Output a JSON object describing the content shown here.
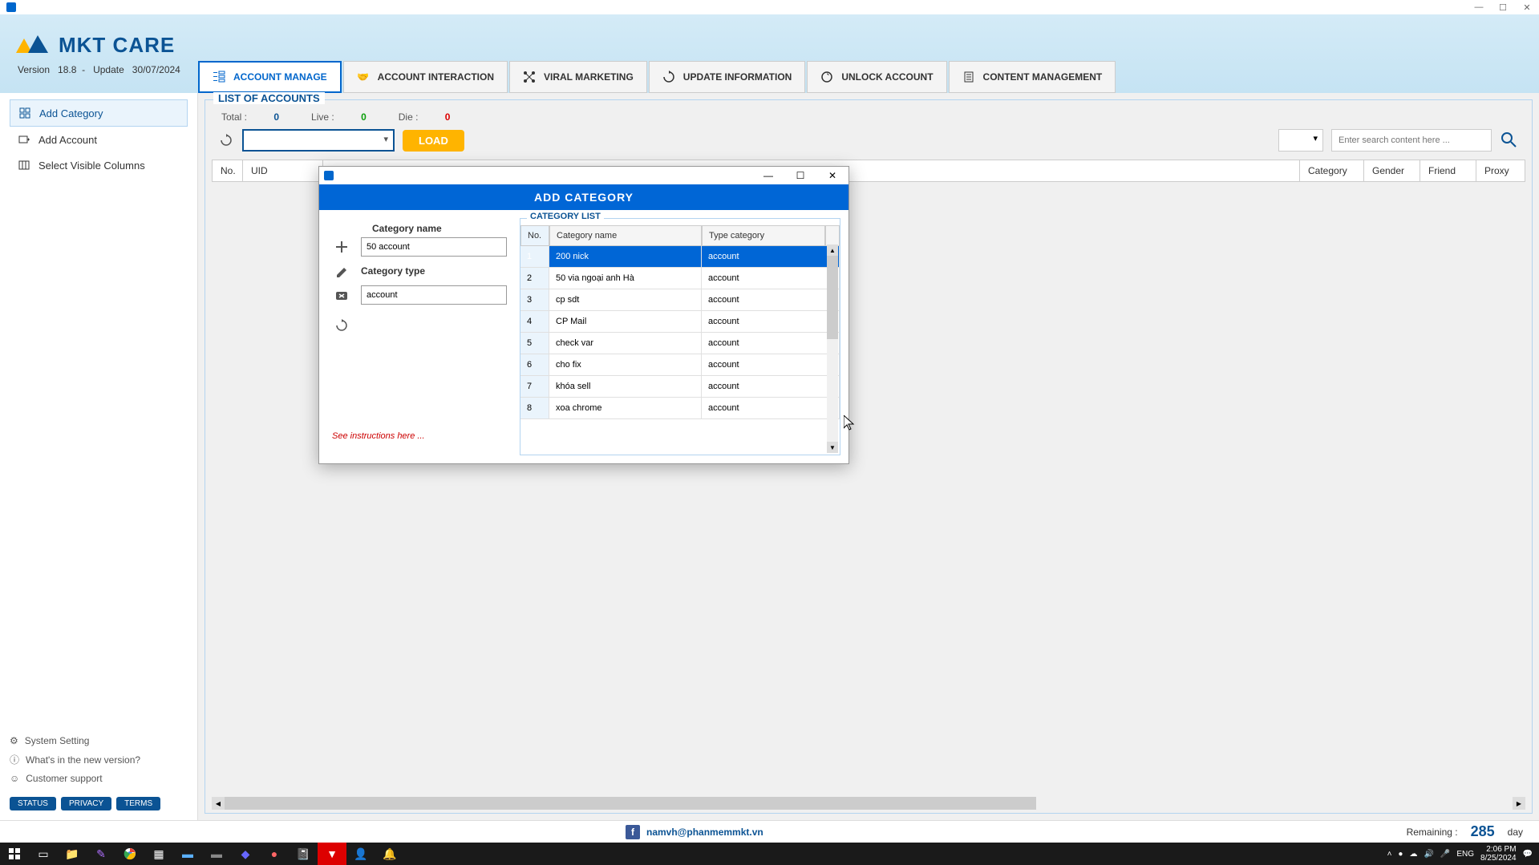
{
  "app": {
    "brand": "MKT CARE",
    "version_label": "Version",
    "version": "18.8",
    "update_label": "Update",
    "update_date": "30/07/2024"
  },
  "tabs": [
    {
      "label": "ACCOUNT MANAGE",
      "active": true
    },
    {
      "label": "ACCOUNT INTERACTION"
    },
    {
      "label": "VIRAL MARKETING"
    },
    {
      "label": "UPDATE INFORMATION"
    },
    {
      "label": "UNLOCK ACCOUNT"
    },
    {
      "label": "CONTENT MANAGEMENT"
    }
  ],
  "sidebar": {
    "items": [
      {
        "label": "Add Category",
        "active": true
      },
      {
        "label": "Add Account"
      },
      {
        "label": "Select Visible Columns"
      }
    ],
    "bottom": [
      {
        "label": "System Setting"
      },
      {
        "label": "What's in the new version?"
      },
      {
        "label": "Customer support"
      }
    ],
    "badges": [
      "STATUS",
      "PRIVACY",
      "TERMS"
    ]
  },
  "panel": {
    "title": "LIST OF ACCOUNTS",
    "stats": {
      "total_label": "Total :",
      "total_val": "0",
      "live_label": "Live :",
      "live_val": "0",
      "die_label": "Die :",
      "die_val": "0"
    },
    "load_btn": "LOAD",
    "search_placeholder": "Enter search content here ...",
    "columns": {
      "no": "No.",
      "uid": "UID",
      "category": "Category",
      "gender": "Gender",
      "friend": "Friend",
      "proxy": "Proxy"
    }
  },
  "modal": {
    "title": "ADD CATEGORY",
    "form": {
      "name_label": "Category name",
      "name_value": "50 account",
      "type_label": "Category type",
      "type_value": "account"
    },
    "instructions": "See instructions here ...",
    "list_title": "CATEGORY LIST",
    "list_columns": {
      "no": "No.",
      "name": "Category name",
      "type": "Type category"
    },
    "rows": [
      {
        "no": "1",
        "name": "200 nick",
        "type": "account",
        "selected": true
      },
      {
        "no": "2",
        "name": "50 via ngoại anh Hà",
        "type": "account"
      },
      {
        "no": "3",
        "name": "cp sdt",
        "type": "account"
      },
      {
        "no": "4",
        "name": "CP Mail",
        "type": "account"
      },
      {
        "no": "5",
        "name": "check var",
        "type": "account"
      },
      {
        "no": "6",
        "name": "cho fix",
        "type": "account"
      },
      {
        "no": "7",
        "name": "khóa sell",
        "type": "account"
      },
      {
        "no": "8",
        "name": "xoa chrome",
        "type": "account"
      }
    ]
  },
  "statusbar": {
    "email": "namvh@phanmemmkt.vn",
    "remaining_label": "Remaining :",
    "remaining_val": "285",
    "remaining_unit": "day"
  },
  "taskbar": {
    "time": "2:06 PM",
    "date": "8/25/2024",
    "lang": "ENG"
  }
}
